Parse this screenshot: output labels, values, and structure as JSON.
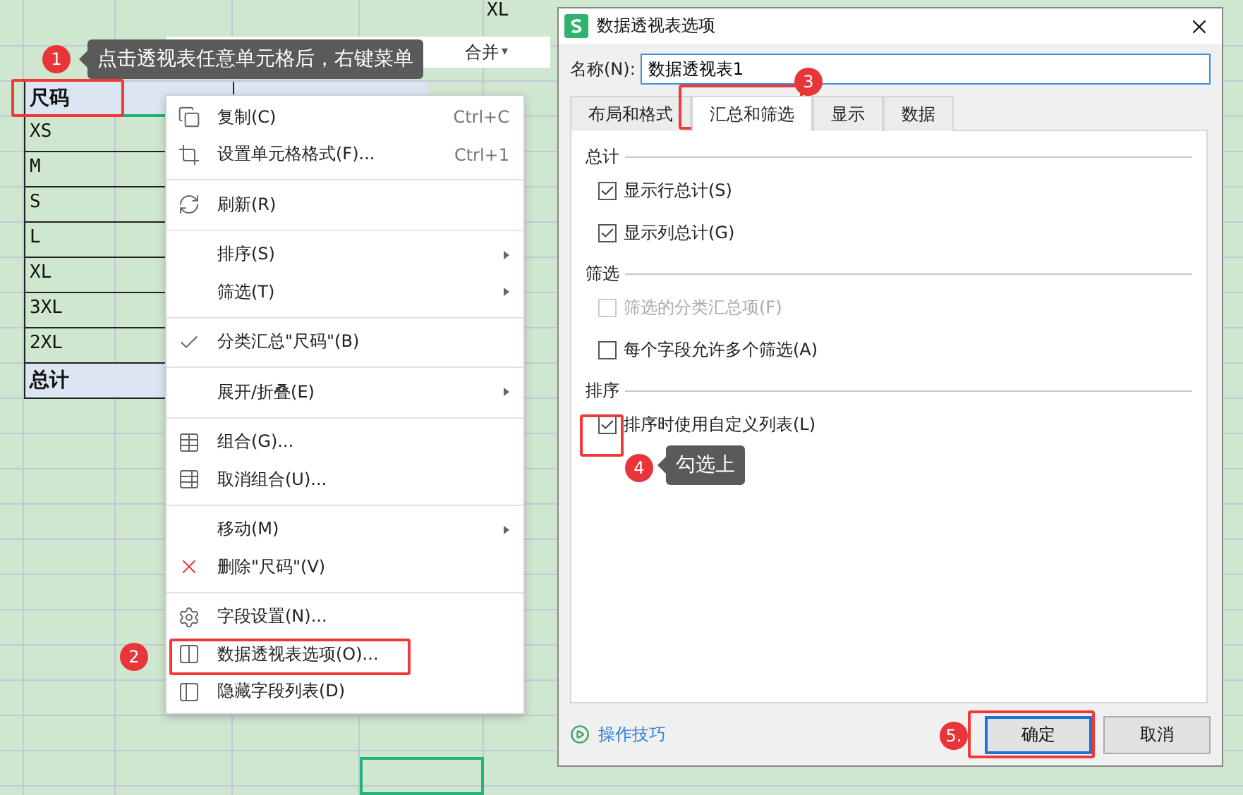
{
  "sheet": {
    "top_cell": "XL",
    "pivot": {
      "headers": [
        "尺码"
      ],
      "rows": [
        "XS",
        "M",
        "S",
        "L",
        "XL",
        "3XL",
        "2XL"
      ],
      "total": "总计"
    }
  },
  "mini_toolbar": {
    "merge": "合并",
    "caret": "▾"
  },
  "context_menu": [
    {
      "kind": "item",
      "label": "复制(C)",
      "shortcut": "Ctrl+C",
      "submenu": false,
      "checked": false
    },
    {
      "kind": "item",
      "label": "设置单元格格式(F)...",
      "shortcut": "Ctrl+1",
      "submenu": false,
      "checked": false
    },
    {
      "kind": "separator"
    },
    {
      "kind": "item",
      "label": "刷新(R)",
      "submenu": false,
      "checked": false
    },
    {
      "kind": "separator"
    },
    {
      "kind": "item",
      "label": "排序(S)",
      "submenu": true,
      "checked": false
    },
    {
      "kind": "item",
      "label": "筛选(T)",
      "submenu": true,
      "checked": false
    },
    {
      "kind": "separator"
    },
    {
      "kind": "item",
      "label": "分类汇总\"尺码\"(B)",
      "submenu": false,
      "checked": true
    },
    {
      "kind": "separator"
    },
    {
      "kind": "item",
      "label": "展开/折叠(E)",
      "submenu": true,
      "checked": false
    },
    {
      "kind": "separator"
    },
    {
      "kind": "item",
      "label": "组合(G)...",
      "submenu": false,
      "checked": false
    },
    {
      "kind": "item",
      "label": "取消组合(U)...",
      "submenu": false,
      "checked": false
    },
    {
      "kind": "separator"
    },
    {
      "kind": "item",
      "label": "移动(M)",
      "submenu": true,
      "checked": false
    },
    {
      "kind": "item",
      "label": "删除\"尺码\"(V)",
      "submenu": false,
      "checked": false
    },
    {
      "kind": "separator"
    },
    {
      "kind": "item",
      "label": "字段设置(N)...",
      "submenu": false,
      "checked": false
    },
    {
      "kind": "item",
      "label": "数据透视表选项(O)...",
      "submenu": false,
      "checked": false
    },
    {
      "kind": "item",
      "label": "隐藏字段列表(D)",
      "submenu": false,
      "checked": false
    }
  ],
  "dialog": {
    "title": "数据透视表选项",
    "name_label": "名称(N):",
    "name_value": "数据透视表1",
    "tabs": [
      {
        "label": "布局和格式",
        "selected": false
      },
      {
        "label": "汇总和筛选",
        "selected": true
      },
      {
        "label": "显示",
        "selected": false
      },
      {
        "label": "数据",
        "selected": false
      }
    ],
    "sections": [
      {
        "title": "总计",
        "options": [
          {
            "label": "显示行总计(S)",
            "checked": true,
            "disabled": false
          },
          {
            "label": "显示列总计(G)",
            "checked": true,
            "disabled": false
          }
        ]
      },
      {
        "title": "筛选",
        "options": [
          {
            "label": "筛选的分类汇总项(F)",
            "checked": false,
            "disabled": true
          },
          {
            "label": "每个字段允许多个筛选(A)",
            "checked": false,
            "disabled": false
          }
        ]
      },
      {
        "title": "排序",
        "options": [
          {
            "label": "排序时使用自定义列表(L)",
            "checked": true,
            "disabled": false
          }
        ]
      }
    ],
    "tips_link": "操作技巧",
    "buttons": [
      {
        "label": "确定",
        "default": true
      },
      {
        "label": "取消",
        "default": false
      }
    ]
  },
  "annotations": [
    {
      "badge": "1",
      "note": "点击透视表任意单元格后，右键菜单"
    },
    {
      "badge": "2"
    },
    {
      "badge": "3"
    },
    {
      "badge": "4",
      "note": "勾选上"
    },
    {
      "badge": "5."
    }
  ]
}
